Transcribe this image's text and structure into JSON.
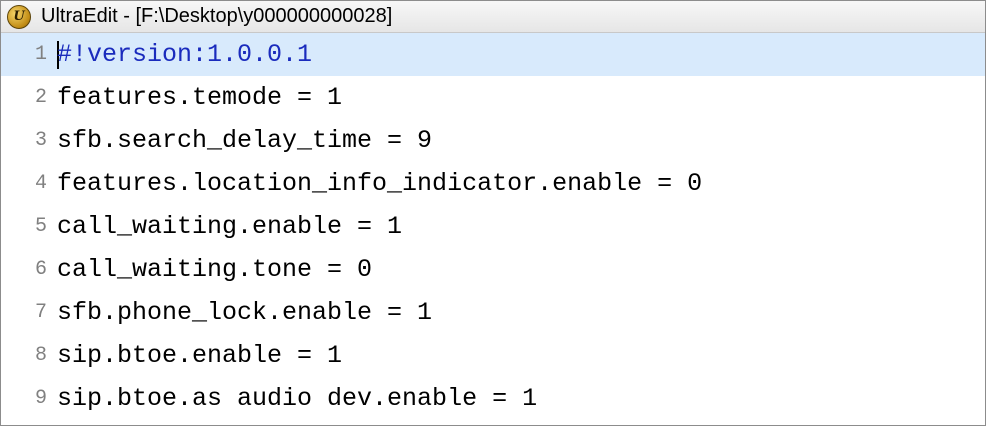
{
  "window": {
    "title": "UltraEdit - [F:\\Desktop\\y000000000028]",
    "icon": "ultraedit-app-icon",
    "icon_glyph": "U"
  },
  "editor": {
    "current_line": 1,
    "lines": [
      {
        "number": "1",
        "text": "#!version:1.0.0.1"
      },
      {
        "number": "2",
        "text": "features.temode = 1"
      },
      {
        "number": "3",
        "text": "sfb.search_delay_time = 9"
      },
      {
        "number": "4",
        "text": "features.location_info_indicator.enable = 0"
      },
      {
        "number": "5",
        "text": "call_waiting.enable = 1"
      },
      {
        "number": "6",
        "text": "call_waiting.tone = 0"
      },
      {
        "number": "7",
        "text": "sfb.phone_lock.enable = 1"
      },
      {
        "number": "8",
        "text": "sip.btoe.enable = 1"
      },
      {
        "number": "9",
        "text": "sip.btoe.as audio dev.enable = 1"
      }
    ]
  },
  "colors": {
    "current_line_bg": "#d8eafc",
    "current_line_text": "#1a2bbd",
    "line_number": "#808080"
  }
}
